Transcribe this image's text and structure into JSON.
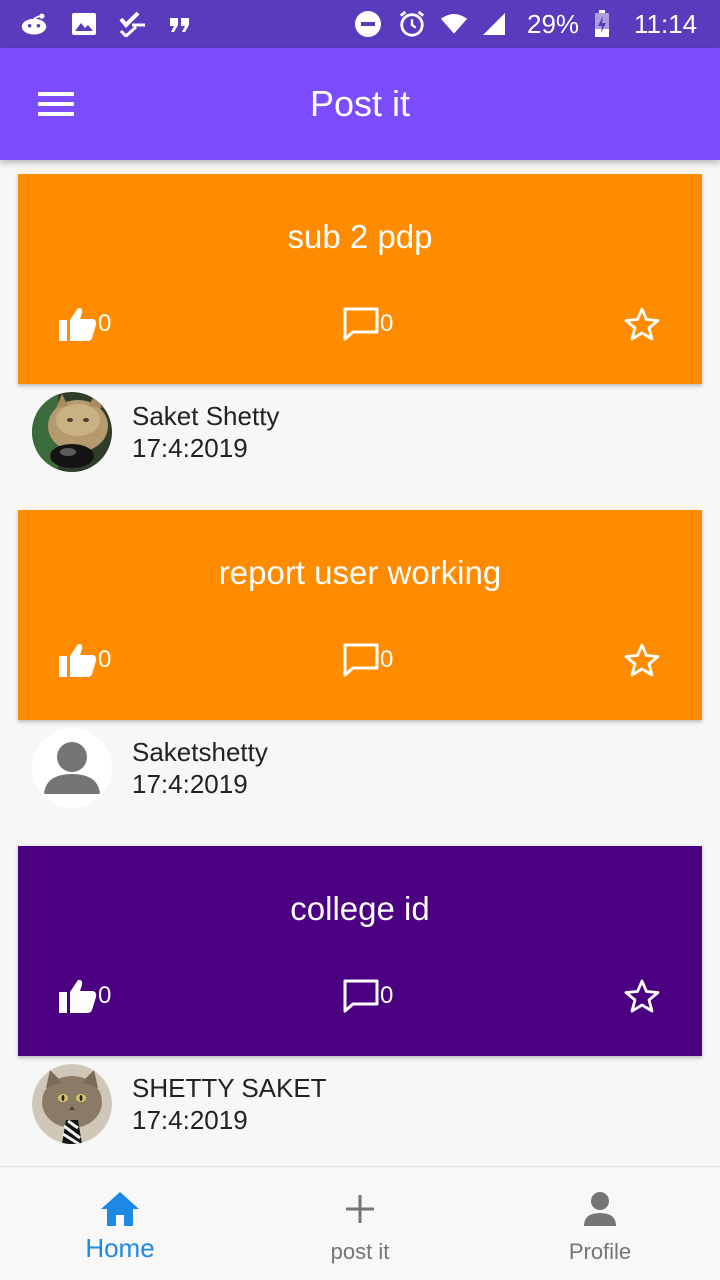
{
  "status_bar": {
    "battery": "29%",
    "time": "11:14",
    "left_icons": [
      "reddit-icon",
      "image-icon",
      "checklist-icon",
      "quote-icon"
    ],
    "right_icons": [
      "do-not-disturb-icon",
      "alarm-icon",
      "wifi-icon",
      "signal-icon",
      "battery-charging-icon"
    ]
  },
  "app_bar": {
    "title": "Post it",
    "menu_icon": "hamburger-menu-icon"
  },
  "colors": {
    "status_bar": "#5a3bbd",
    "app_bar": "#7c4dff",
    "orange_card": "#ff8c00",
    "purple_card": "#4a0080",
    "nav_active": "#1e88e5",
    "nav_inactive": "#757575"
  },
  "posts": [
    {
      "text": "sub 2 pdp",
      "color": "#ff8c00",
      "likes": "0",
      "comments": "0",
      "author": "Saket Shetty",
      "date": "17:4:2019",
      "avatar": "cat-photo"
    },
    {
      "text": "report user working",
      "color": "#ff8c00",
      "likes": "0",
      "comments": "0",
      "author": "Saketshetty",
      "date": "17:4:2019",
      "avatar": "default-person"
    },
    {
      "text": "college id",
      "color": "#4a0080",
      "likes": "0",
      "comments": "0",
      "author": "SHETTY SAKET",
      "date": "17:4:2019",
      "avatar": "cat-with-tie-photo"
    }
  ],
  "bottom_nav": [
    {
      "label": "Home",
      "icon": "home-icon",
      "active": true
    },
    {
      "label": "post it",
      "icon": "plus-icon",
      "active": false
    },
    {
      "label": "Profile",
      "icon": "person-icon",
      "active": false
    }
  ]
}
